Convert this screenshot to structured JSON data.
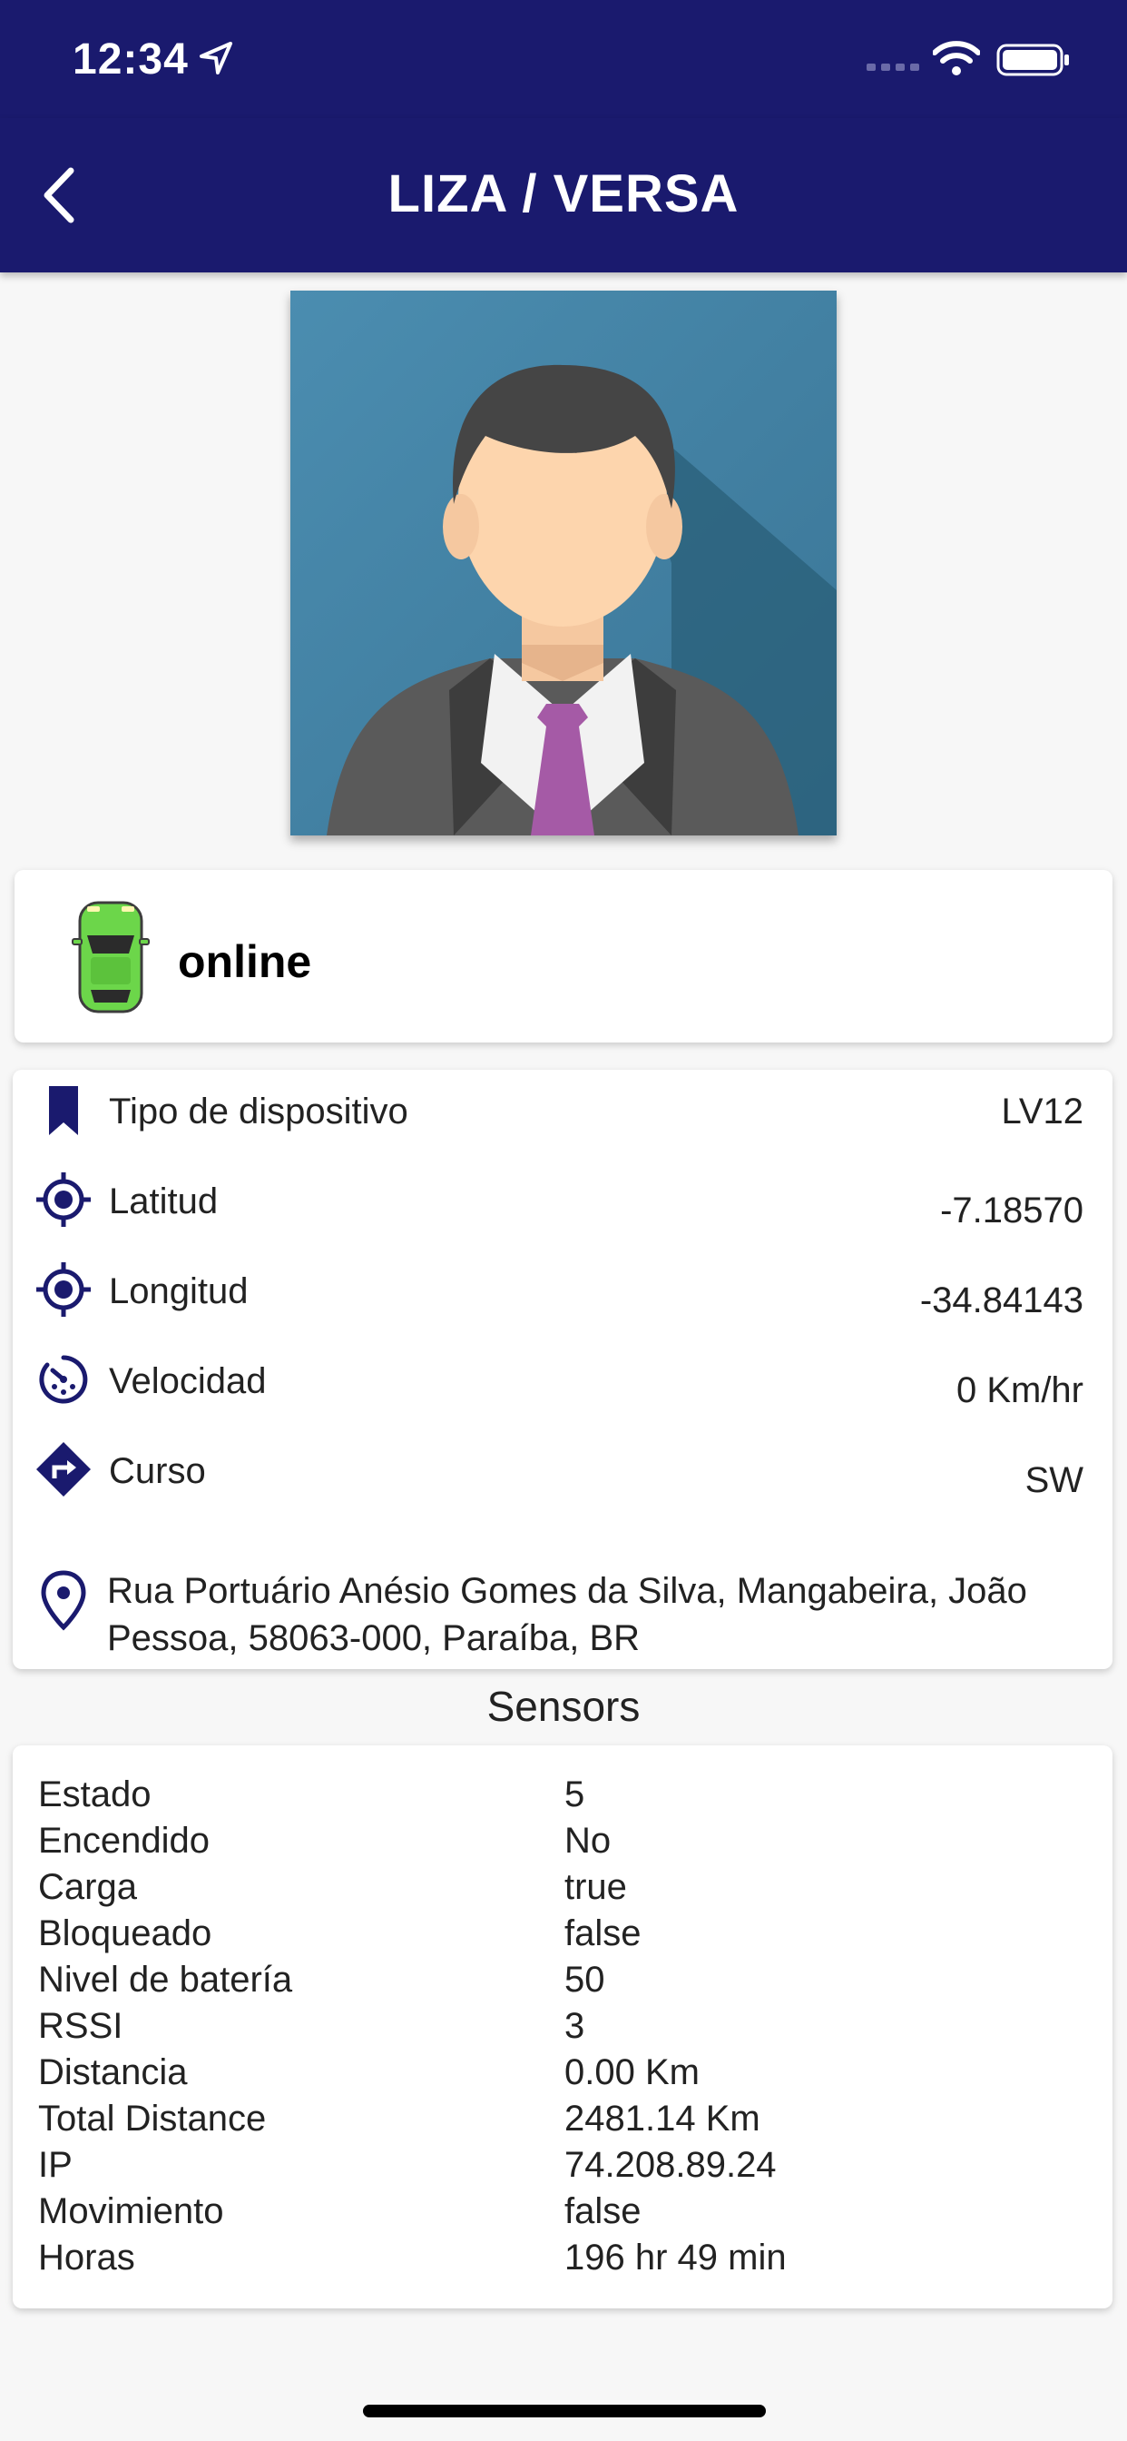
{
  "status_bar": {
    "time": "12:34"
  },
  "header": {
    "title": "LIZA / VERSA"
  },
  "status": {
    "label": "online",
    "car_color": "#6cd64a"
  },
  "info": [
    {
      "icon": "bookmark-icon",
      "label": "Tipo de dispositivo",
      "value": "LV12"
    },
    {
      "icon": "crosshair-icon",
      "label": "Latitud",
      "value": "-7.18570"
    },
    {
      "icon": "crosshair-icon",
      "label": "Longitud",
      "value": "-34.84143"
    },
    {
      "icon": "speedometer-icon",
      "label": "Velocidad",
      "value": "0 Km/hr"
    },
    {
      "icon": "direction-sign-icon",
      "label": "Curso",
      "value": "SW"
    }
  ],
  "address": "Rua Portuário Anésio Gomes da Silva, Mangabeira, João Pessoa, 58063-000, Paraíba, BR",
  "sensors": {
    "title": "Sensors",
    "rows": [
      {
        "key": "Estado",
        "value": "5"
      },
      {
        "key": "Encendido",
        "value": "No"
      },
      {
        "key": "Carga",
        "value": "true"
      },
      {
        "key": "Bloqueado",
        "value": "false"
      },
      {
        "key": "Nivel de batería",
        "value": "50"
      },
      {
        "key": "RSSI",
        "value": "3"
      },
      {
        "key": "Distancia",
        "value": "0.00 Km"
      },
      {
        "key": "Total Distance",
        "value": "2481.14 Km"
      },
      {
        "key": "IP",
        "value": "74.208.89.24"
      },
      {
        "key": "Movimiento",
        "value": "false"
      },
      {
        "key": "Horas",
        "value": "196 hr 49 min"
      }
    ]
  },
  "colors": {
    "header": "#1a1a6e",
    "icon": "#1a1a6e",
    "avatar_bg": "#4a8aad"
  }
}
